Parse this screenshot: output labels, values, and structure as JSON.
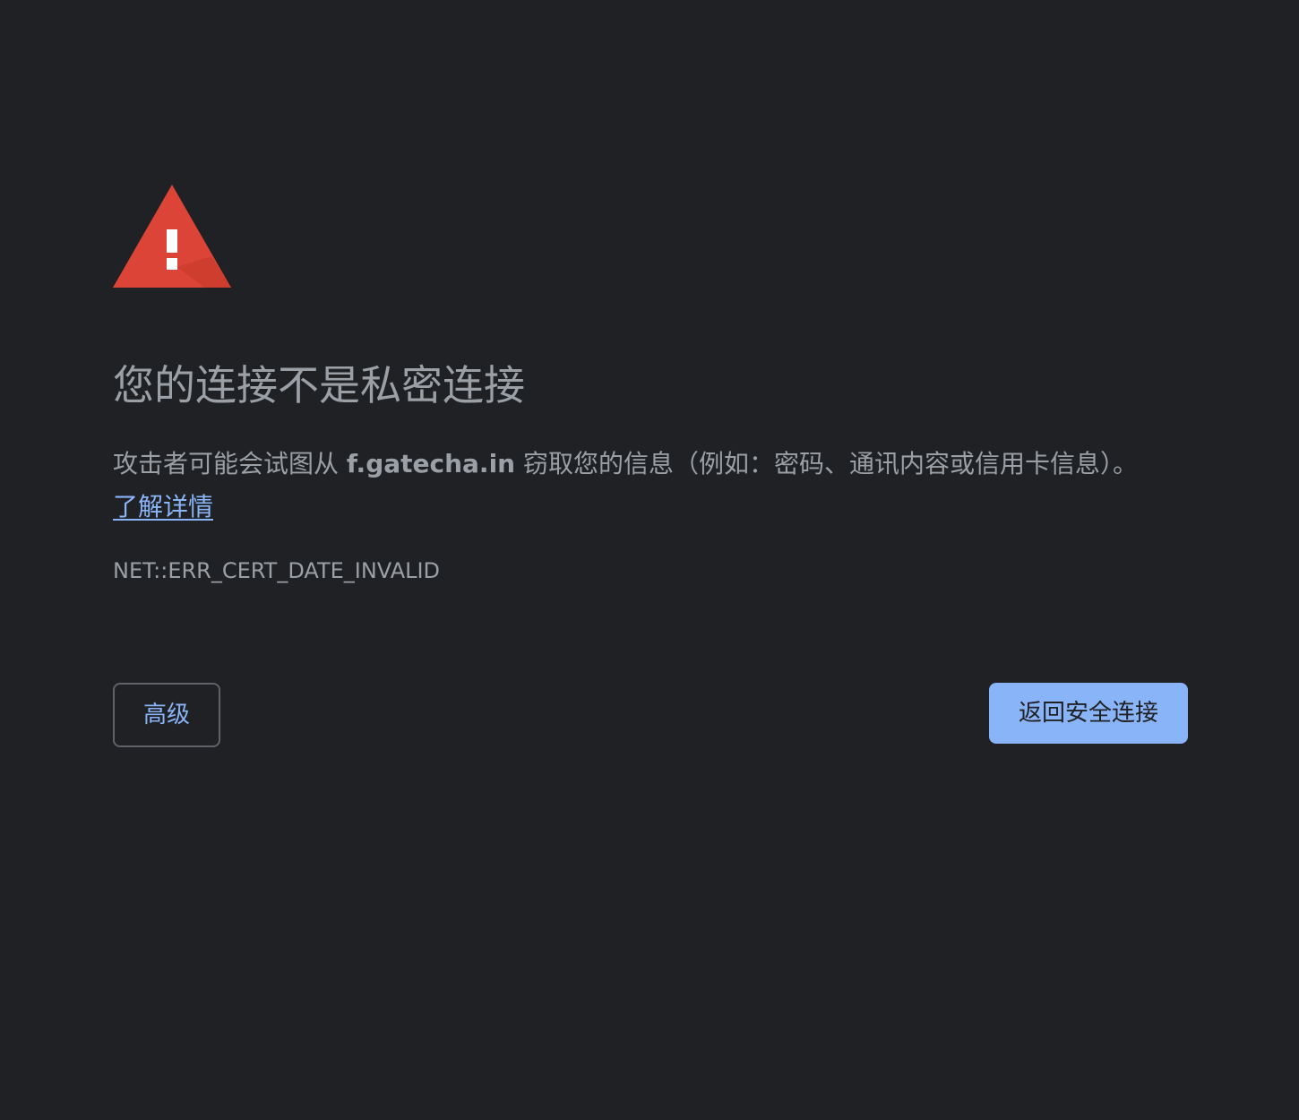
{
  "page": {
    "title": "您的连接不是私密连接",
    "description_before": "攻击者可能会试图从 ",
    "domain": "f.gatecha.in",
    "description_after": " 窃取您的信息（例如：密码、通讯内容或信用卡信息）。",
    "learn_more_label": "了解详情",
    "error_code": "NET::ERR_CERT_DATE_INVALID"
  },
  "buttons": {
    "advanced_label": "高级",
    "back_label": "返回安全连接"
  },
  "icon": {
    "name": "warning-triangle-icon",
    "color": "#db4437"
  },
  "colors": {
    "background": "#202124",
    "text": "#9aa0a6",
    "link": "#8ab4f8",
    "primary_button": "#8ab4f8"
  }
}
